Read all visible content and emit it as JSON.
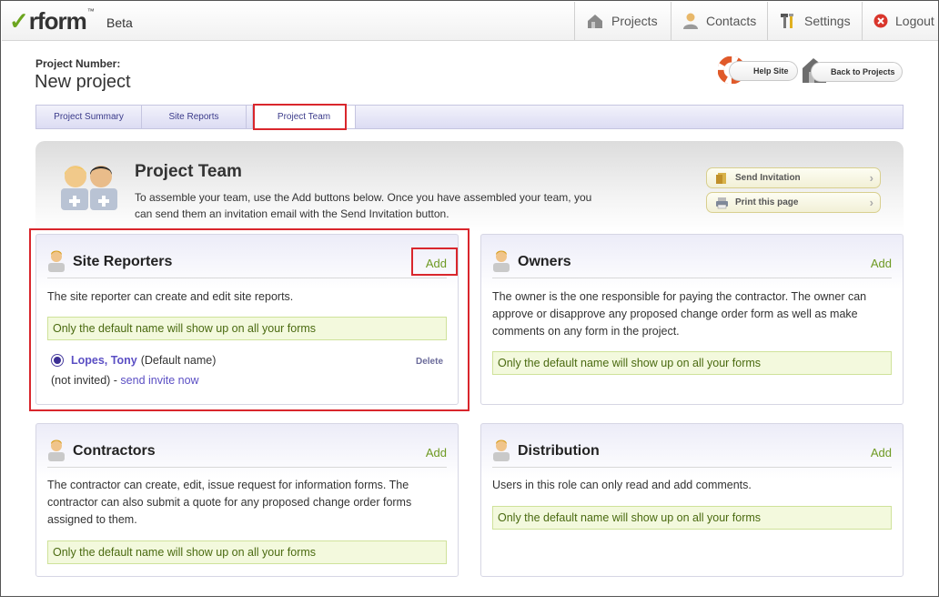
{
  "app": {
    "logo": "rform",
    "logo_tm": "™",
    "beta": "Beta"
  },
  "nav": {
    "projects": "Projects",
    "contacts": "Contacts",
    "settings": "Settings",
    "logout": "Logout"
  },
  "project": {
    "number_label": "Project Number:",
    "name": "New project"
  },
  "header_buttons": {
    "help": "Help Site",
    "back": "Back to Projects"
  },
  "tabs": [
    {
      "label": "Project Summary"
    },
    {
      "label": "Site Reports"
    },
    {
      "label": "Project Team",
      "active": true
    }
  ],
  "team": {
    "title": "Project Team",
    "description": "To assemble your team, use the Add buttons below. Once you have assembled your team, you can send them an invitation email with the Send Invitation button.",
    "send_invitation": "Send Invitation",
    "print_page": "Print this page"
  },
  "roles": {
    "site_reporters": {
      "title": "Site Reporters",
      "add": "Add",
      "description": "The site reporter can create and edit site reports.",
      "note": "Only the default name will show up on all your forms",
      "member_name": "Lopes, Tony",
      "member_suffix": "(Default name)",
      "delete": "Delete",
      "status": "(not invited) - ",
      "invite_link": "send invite now"
    },
    "owners": {
      "title": "Owners",
      "add": "Add",
      "description": "The owner is the one responsible for paying the contractor. The owner can approve or disapprove any proposed change order form as well as make comments on any form in the project.",
      "note": "Only the default name will show up on all your forms"
    },
    "contractors": {
      "title": "Contractors",
      "add": "Add",
      "description": "The contractor can create, edit, issue request for information forms. The contractor can also submit a quote for any proposed change order forms assigned to them.",
      "note": "Only the default name will show up on all your forms"
    },
    "distribution": {
      "title": "Distribution",
      "add": "Add",
      "description": "Users in this role can only read and add comments.",
      "note": "Only the default name will show up on all your forms"
    }
  },
  "colors": {
    "accent_green": "#6e9a22",
    "link_purple": "#5b4fc4",
    "highlight_red": "#d9262c",
    "note_bg": "#f3f9dd"
  }
}
